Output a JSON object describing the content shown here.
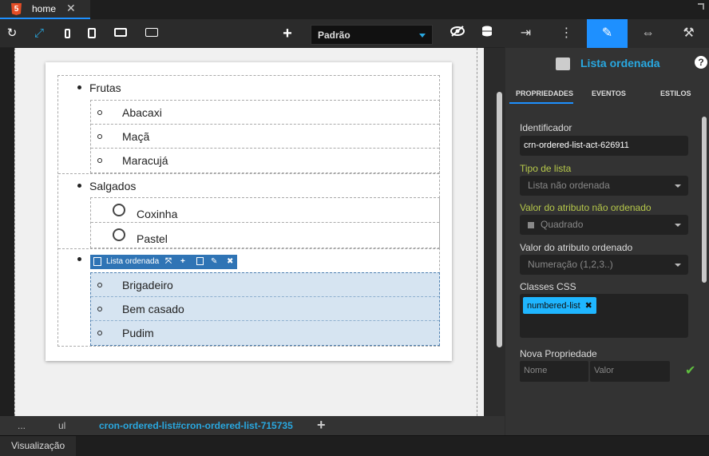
{
  "tab": {
    "name": "home",
    "close": "✕",
    "html5": "5"
  },
  "toolbar": {
    "refresh_icon": "↻",
    "expand_icon": "⤢",
    "add_icon": "+",
    "viewport_select": "Padrão"
  },
  "canvas": {
    "outer_items": [
      {
        "label": "Frutas",
        "children": [
          "Abacaxi",
          "Maçã",
          "Maracujá"
        ]
      },
      {
        "label": "Salgados",
        "children": [
          "Coxinha",
          "Pastel"
        ]
      }
    ],
    "selected_list": {
      "toolbar_label": "Lista ordenada",
      "items": [
        "Brigadeiro",
        "Bem casado",
        "Pudim"
      ]
    }
  },
  "breadcrumbs": {
    "ellipsis": "...",
    "ul": "ul",
    "current": "cron-ordered-list#cron-ordered-list-715735",
    "add": "+"
  },
  "bottom": {
    "visualizacao": "Visualização"
  },
  "right_panel": {
    "title": "Lista ordenada",
    "help": "?",
    "subtabs": [
      "PROPRIEDADES",
      "EVENTOS",
      "ESTILOS"
    ],
    "identificador_label": "Identificador",
    "identificador_value": "crn-ordered-list-act-626911",
    "tipo_label": "Tipo de lista",
    "tipo_value": "Lista não ordenada",
    "nao_ordenado_label": "Valor do atributo não ordenado",
    "nao_ordenado_value": "Quadrado",
    "ordenado_label": "Valor do atributo ordenado",
    "ordenado_value": "Numeração (1,2,3..)",
    "classes_label": "Classes CSS",
    "class_chip": "numbered-list",
    "chip_close": "✖",
    "nova_label": "Nova Propriedade",
    "nome_placeholder": "Nome",
    "valor_placeholder": "Valor",
    "check": "✔"
  }
}
